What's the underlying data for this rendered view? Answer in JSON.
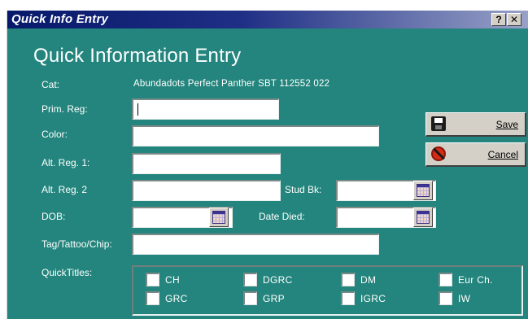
{
  "window": {
    "title": "Quick Info Entry",
    "help_label": "?",
    "close_label": "✕"
  },
  "heading": "Quick Information Entry",
  "cat": {
    "label": "Cat:",
    "value": "Abundadots Perfect Panther SBT 112552 022"
  },
  "fields": {
    "prim_reg": {
      "label": "Prim. Reg:",
      "value": ""
    },
    "color": {
      "label": "Color:",
      "value": ""
    },
    "alt_reg1": {
      "label": "Alt. Reg. 1:",
      "value": ""
    },
    "alt_reg2": {
      "label": "Alt. Reg. 2",
      "value": ""
    },
    "stud_bk": {
      "label": "Stud Bk:",
      "value": ""
    },
    "dob": {
      "label": "DOB:",
      "value": ""
    },
    "date_died": {
      "label": "Date Died:",
      "value": ""
    },
    "tag": {
      "label": "Tag/Tattoo/Chip:",
      "value": ""
    }
  },
  "buttons": {
    "save": "Save",
    "cancel": "Cancel"
  },
  "quicktitles": {
    "label": "QuickTitles:",
    "items": [
      "CH",
      "DGRC",
      "DM",
      "Eur Ch.",
      "GRC",
      "GRP",
      "IGRC",
      "IW"
    ]
  },
  "colors": {
    "background": "#23857d",
    "titlebar": "#07196a"
  }
}
